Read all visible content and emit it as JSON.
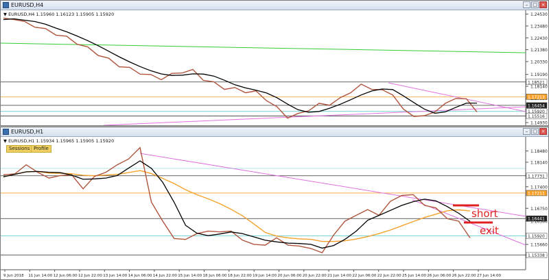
{
  "colors": {
    "price_line": "#222222",
    "bar": "#b0543c",
    "ma_black": "#000000",
    "ma_orange": "#f5a12a",
    "green_line": "#33cc33",
    "magenta_line": "#e070e0",
    "cyan_line": "#66cccc",
    "orange_level": "#f5a12a",
    "annotation_red": "#e02020",
    "sessions_badge": "#f0d060"
  },
  "window_h4": {
    "title": "EURUSD,H4",
    "info": "▼ EURUSD,H4  1.15960 1.16123 1.15905 1.15920",
    "price_axis": [
      "1.24530",
      "1.23480",
      "1.22430",
      "1.21380",
      "1.20330",
      "1.19190",
      "1.18140",
      "1.17090",
      "1.16040",
      "1.14930"
    ],
    "level_labels": [
      "1.18521",
      "1.17213",
      "1.16454",
      "1.15920",
      "1.15516"
    ],
    "chart_data": {
      "type": "line",
      "title": "EURUSD,H4",
      "ylim": [
        1.1493,
        1.2463
      ],
      "series": [
        {
          "name": "EURUSD",
          "values": [
            1.2405,
            1.2418,
            1.2375,
            1.235,
            1.2312,
            1.228,
            1.2245,
            1.22,
            1.215,
            1.21,
            1.205,
            1.2,
            1.1968,
            1.1935,
            1.1905,
            1.1885,
            1.1915,
            1.1945,
            1.195,
            1.188,
            1.184,
            1.18,
            1.179,
            1.177,
            1.176,
            1.17,
            1.162,
            1.1545,
            1.156,
            1.161,
            1.165,
            1.166,
            1.17,
            1.177,
            1.182,
            1.18,
            1.177,
            1.175,
            1.16,
            1.156,
            1.154,
            1.16,
            1.165,
            1.172,
            1.169,
            1.16
          ]
        }
      ]
    }
  },
  "window_h1": {
    "title": "EURUSD,H1",
    "info": "▼ EURUSD,H1  1.15934 1.15965 1.15905 1.15920",
    "sessions_label": "Sessions",
    "profile_label": "Profile",
    "price_axis": [
      "1.18480",
      "1.18140",
      "1.17750",
      "1.17400",
      "1.16750",
      "1.16360",
      "1.15660",
      "1.15330"
    ],
    "level_labels": [
      "1.17731",
      "1.17211",
      "1.16441",
      "1.15920",
      "1.15338"
    ],
    "time_axis": [
      "9 Jun 2018",
      "11 Jun 14:00",
      "12 Jun 06:00",
      "12 Jun 22:00",
      "13 Jun 14:00",
      "14 Jun 06:00",
      "14 Jun 22:00",
      "15 Jun 14:00",
      "18 Jun 06:00",
      "18 Jun 22:00",
      "19 Jun 14:00",
      "20 Jun 06:00",
      "20 Jun 22:00",
      "21 Jun 14:00",
      "22 Jun 06:00",
      "22 Jun 22:00",
      "25 Jun 14:00",
      "26 Jun 06:00",
      "26 Jun 22:00",
      "27 Jun 14:00"
    ],
    "annotations": {
      "short": "short",
      "exit": "exit"
    },
    "chart_data": {
      "type": "line",
      "title": "EURUSD,H1",
      "ylim": [
        1.15,
        1.188
      ],
      "series": [
        {
          "name": "EURUSD",
          "values": [
            1.177,
            1.1785,
            1.18,
            1.179,
            1.176,
            1.178,
            1.177,
            1.174,
            1.1765,
            1.179,
            1.18,
            1.183,
            1.1852,
            1.17,
            1.163,
            1.159,
            1.1575,
            1.1605,
            1.16,
            1.161,
            1.16,
            1.1585,
            1.156,
            1.157,
            1.158,
            1.157,
            1.1555,
            1.156,
            1.1535,
            1.16,
            1.163,
            1.166,
            1.1665,
            1.166,
            1.169,
            1.172,
            1.171,
            1.169,
            1.167,
            1.165,
            1.163,
            1.1592
          ]
        }
      ]
    }
  }
}
